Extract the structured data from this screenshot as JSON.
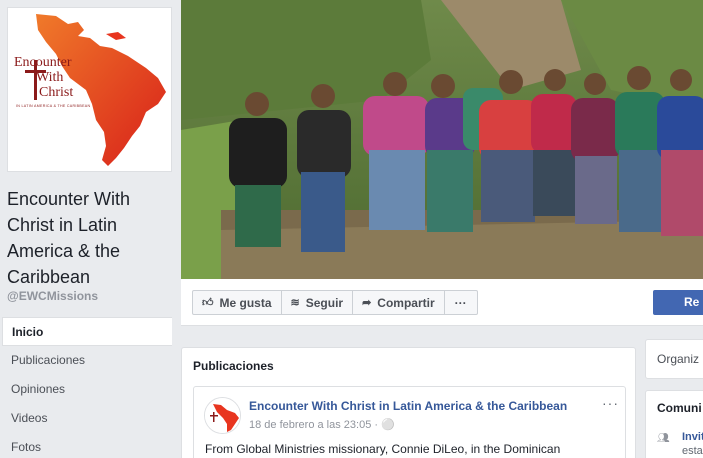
{
  "page": {
    "name": "Encounter With Christ in Latin America & the Caribbean",
    "handle": "@EWCMissions"
  },
  "logo": {
    "line1": "Encounter",
    "line2": "With",
    "line3": "Christ",
    "subtitle": "IN LATIN AMERICA & THE CARIBBEAN"
  },
  "nav": {
    "items": [
      {
        "label": "Inicio"
      },
      {
        "label": "Publicaciones"
      },
      {
        "label": "Opiniones"
      },
      {
        "label": "Videos"
      },
      {
        "label": "Fotos"
      }
    ]
  },
  "actions": {
    "like": "Me gusta",
    "follow": "Seguir",
    "share": "Compartir",
    "more": "···",
    "primary": "Re"
  },
  "posts": {
    "title": "Publicaciones",
    "items": [
      {
        "author": "Encounter With Christ in Latin America & the Caribbean",
        "time": "18 de febrero a las 23:05 · ",
        "text": "From Global Ministries missionary, Connie DiLeo, in the Dominican"
      }
    ],
    "more": "···"
  },
  "right": {
    "card1_label": "Organiz",
    "card2_title": "Comuni",
    "card2_link": "Invit",
    "card2_sub": "esta"
  },
  "colors": {
    "link": "#365899",
    "primary": "#4267b2",
    "logo_red": "#e8351f"
  }
}
